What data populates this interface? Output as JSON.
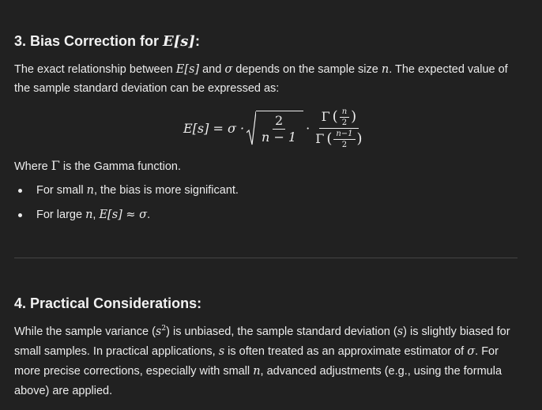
{
  "section3": {
    "heading_prefix": "3. Bias Correction for ",
    "heading_math": "E[s]",
    "heading_suffix": ":",
    "p1_a": "The exact relationship between ",
    "p1_math1": "E[s]",
    "p1_b": " and ",
    "p1_math2": "σ",
    "p1_c": " depends on the sample size ",
    "p1_math3": "n",
    "p1_d": ". The expected value of the sample standard deviation can be expressed as:",
    "formula": {
      "lhs": "E[s] = σ ·",
      "sqrt_num": "2",
      "sqrt_den": "n − 1",
      "dot": "·",
      "gamma": "Γ",
      "g_num_top": "n",
      "g_num_bot": "2",
      "g_den_top": "n−1",
      "g_den_bot": "2"
    },
    "p2_a": "Where ",
    "p2_math": "Γ",
    "p2_b": " is the Gamma function.",
    "bullet1_a": "For small ",
    "bullet1_math": "n",
    "bullet1_b": ", the bias is more significant.",
    "bullet2_a": "For large ",
    "bullet2_math1": "n",
    "bullet2_b": ", ",
    "bullet2_math2": "E[s] ≈ σ",
    "bullet2_c": "."
  },
  "section4": {
    "heading": "4. Practical Considerations:",
    "t1": "While the sample variance (",
    "m1": "s",
    "m1sup": "2",
    "t2": ") is unbiased, the sample standard deviation (",
    "m2": "s",
    "t3": ") is slightly biased for small samples. In practical applications, ",
    "m3": "s",
    "t4": " is often treated as an approximate estimator of ",
    "m4": "σ",
    "t5": ". For more precise corrections, especially with small ",
    "m5": "n",
    "t6": ", advanced adjustments (e.g., using the formula above) are applied."
  }
}
